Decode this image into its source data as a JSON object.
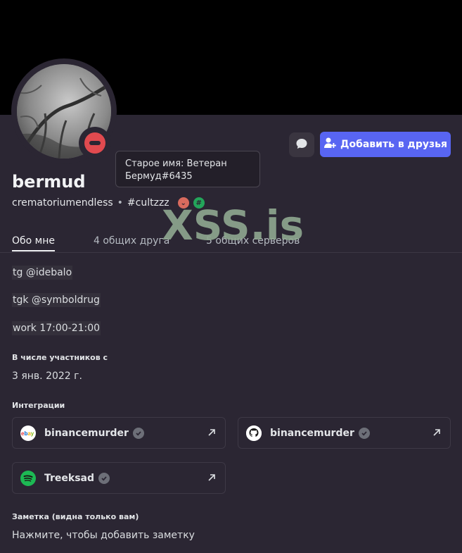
{
  "profile": {
    "username": "bermud",
    "handle": "crematoriumendless",
    "separator": "•",
    "tag": "#cultzzz",
    "status": "do-not-disturb"
  },
  "tooltip": {
    "line1": "Старое имя: Ветеран",
    "line2": "Бермуд#6435"
  },
  "actions": {
    "add_friend_label": "Добавить в друзья"
  },
  "watermark": "XSS.is",
  "tabs": [
    {
      "label": "Обо мне",
      "active": true
    },
    {
      "label": "4 общих друга",
      "active": false
    },
    {
      "label": "5 общих серверов",
      "active": false
    }
  ],
  "bio": [
    "tg @idebalo",
    "tgk @symboldrug",
    "work 17:00-21:00"
  ],
  "member_since": {
    "title": "В числе участников с",
    "date": "3 янв. 2022 г."
  },
  "integrations": {
    "title": "Интеграции",
    "items": [
      {
        "service": "ebay",
        "name": "binancemurder"
      },
      {
        "service": "github",
        "name": "binancemurder"
      },
      {
        "service": "spotify",
        "name": "Treeksad"
      }
    ]
  },
  "note": {
    "title": "Заметка (видна только вам)",
    "placeholder": "Нажмите, чтобы добавить заметку"
  },
  "colors": {
    "accent": "#5865f2",
    "dnd": "#e14a4f",
    "spotify": "#1db954"
  }
}
